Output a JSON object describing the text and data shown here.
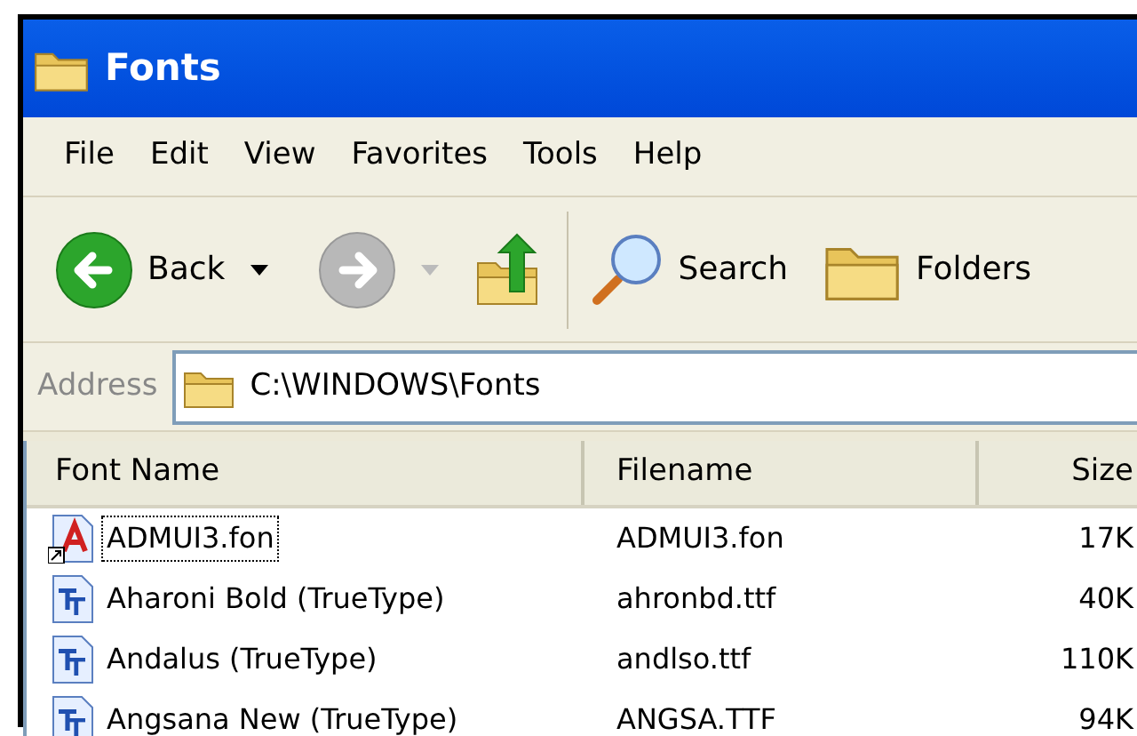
{
  "window": {
    "title": "Fonts"
  },
  "menu": [
    "File",
    "Edit",
    "View",
    "Favorites",
    "Tools",
    "Help"
  ],
  "toolbar": {
    "back": {
      "label": "Back",
      "disabled": false
    },
    "forward": {
      "disabled": true
    },
    "search": "Search",
    "folders": "Folders"
  },
  "address": {
    "label": "Address",
    "value": "C:\\WINDOWS\\Fonts"
  },
  "table": {
    "columns": [
      "Font Name",
      "Filename",
      "Size"
    ],
    "rows": [
      {
        "kind": "raster",
        "name": "ADMUI3.fon",
        "filename": "ADMUI3.fon",
        "size": "17K",
        "focused": true,
        "shortcut": true
      },
      {
        "kind": "truetype",
        "name": "Aharoni Bold (TrueType)",
        "filename": "ahronbd.ttf",
        "size": "40K",
        "focused": false,
        "shortcut": false
      },
      {
        "kind": "truetype",
        "name": "Andalus (TrueType)",
        "filename": "andlso.ttf",
        "size": "110K",
        "focused": false,
        "shortcut": false
      },
      {
        "kind": "truetype",
        "name": "Angsana New (TrueType)",
        "filename": "ANGSA.TTF",
        "size": "94K",
        "focused": false,
        "shortcut": false
      }
    ]
  }
}
